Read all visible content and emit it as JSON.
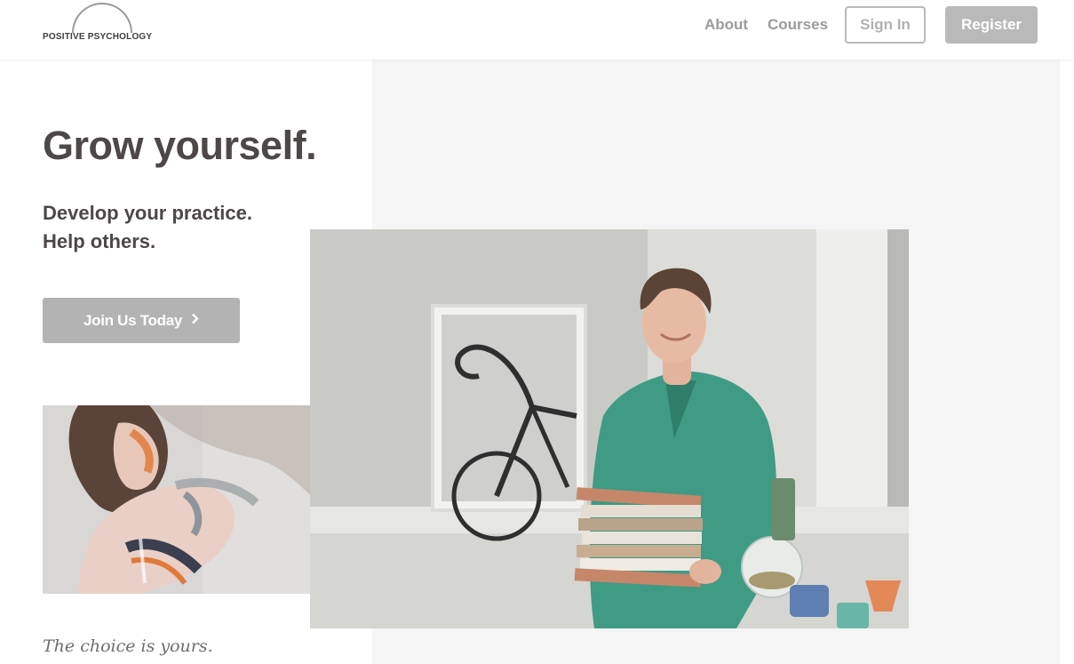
{
  "header": {
    "logo_text": "POSITIVE PSYCHOLOGY",
    "nav": {
      "about": "About",
      "courses": "Courses"
    },
    "sign_in": "Sign In",
    "register": "Register"
  },
  "hero": {
    "title": "Grow yourself.",
    "subtitle_line1": "Develop your practice.",
    "subtitle_line2": "Help others.",
    "cta_label": "Join Us Today",
    "cta_icon": "chevron-right-icon",
    "tagline": "The choice is yours."
  },
  "colors": {
    "heading": "#4d4747",
    "button_gray": "#b3b3b3",
    "nav_gray": "#9b9b9b",
    "panel_bg": "#f5f5f5"
  }
}
